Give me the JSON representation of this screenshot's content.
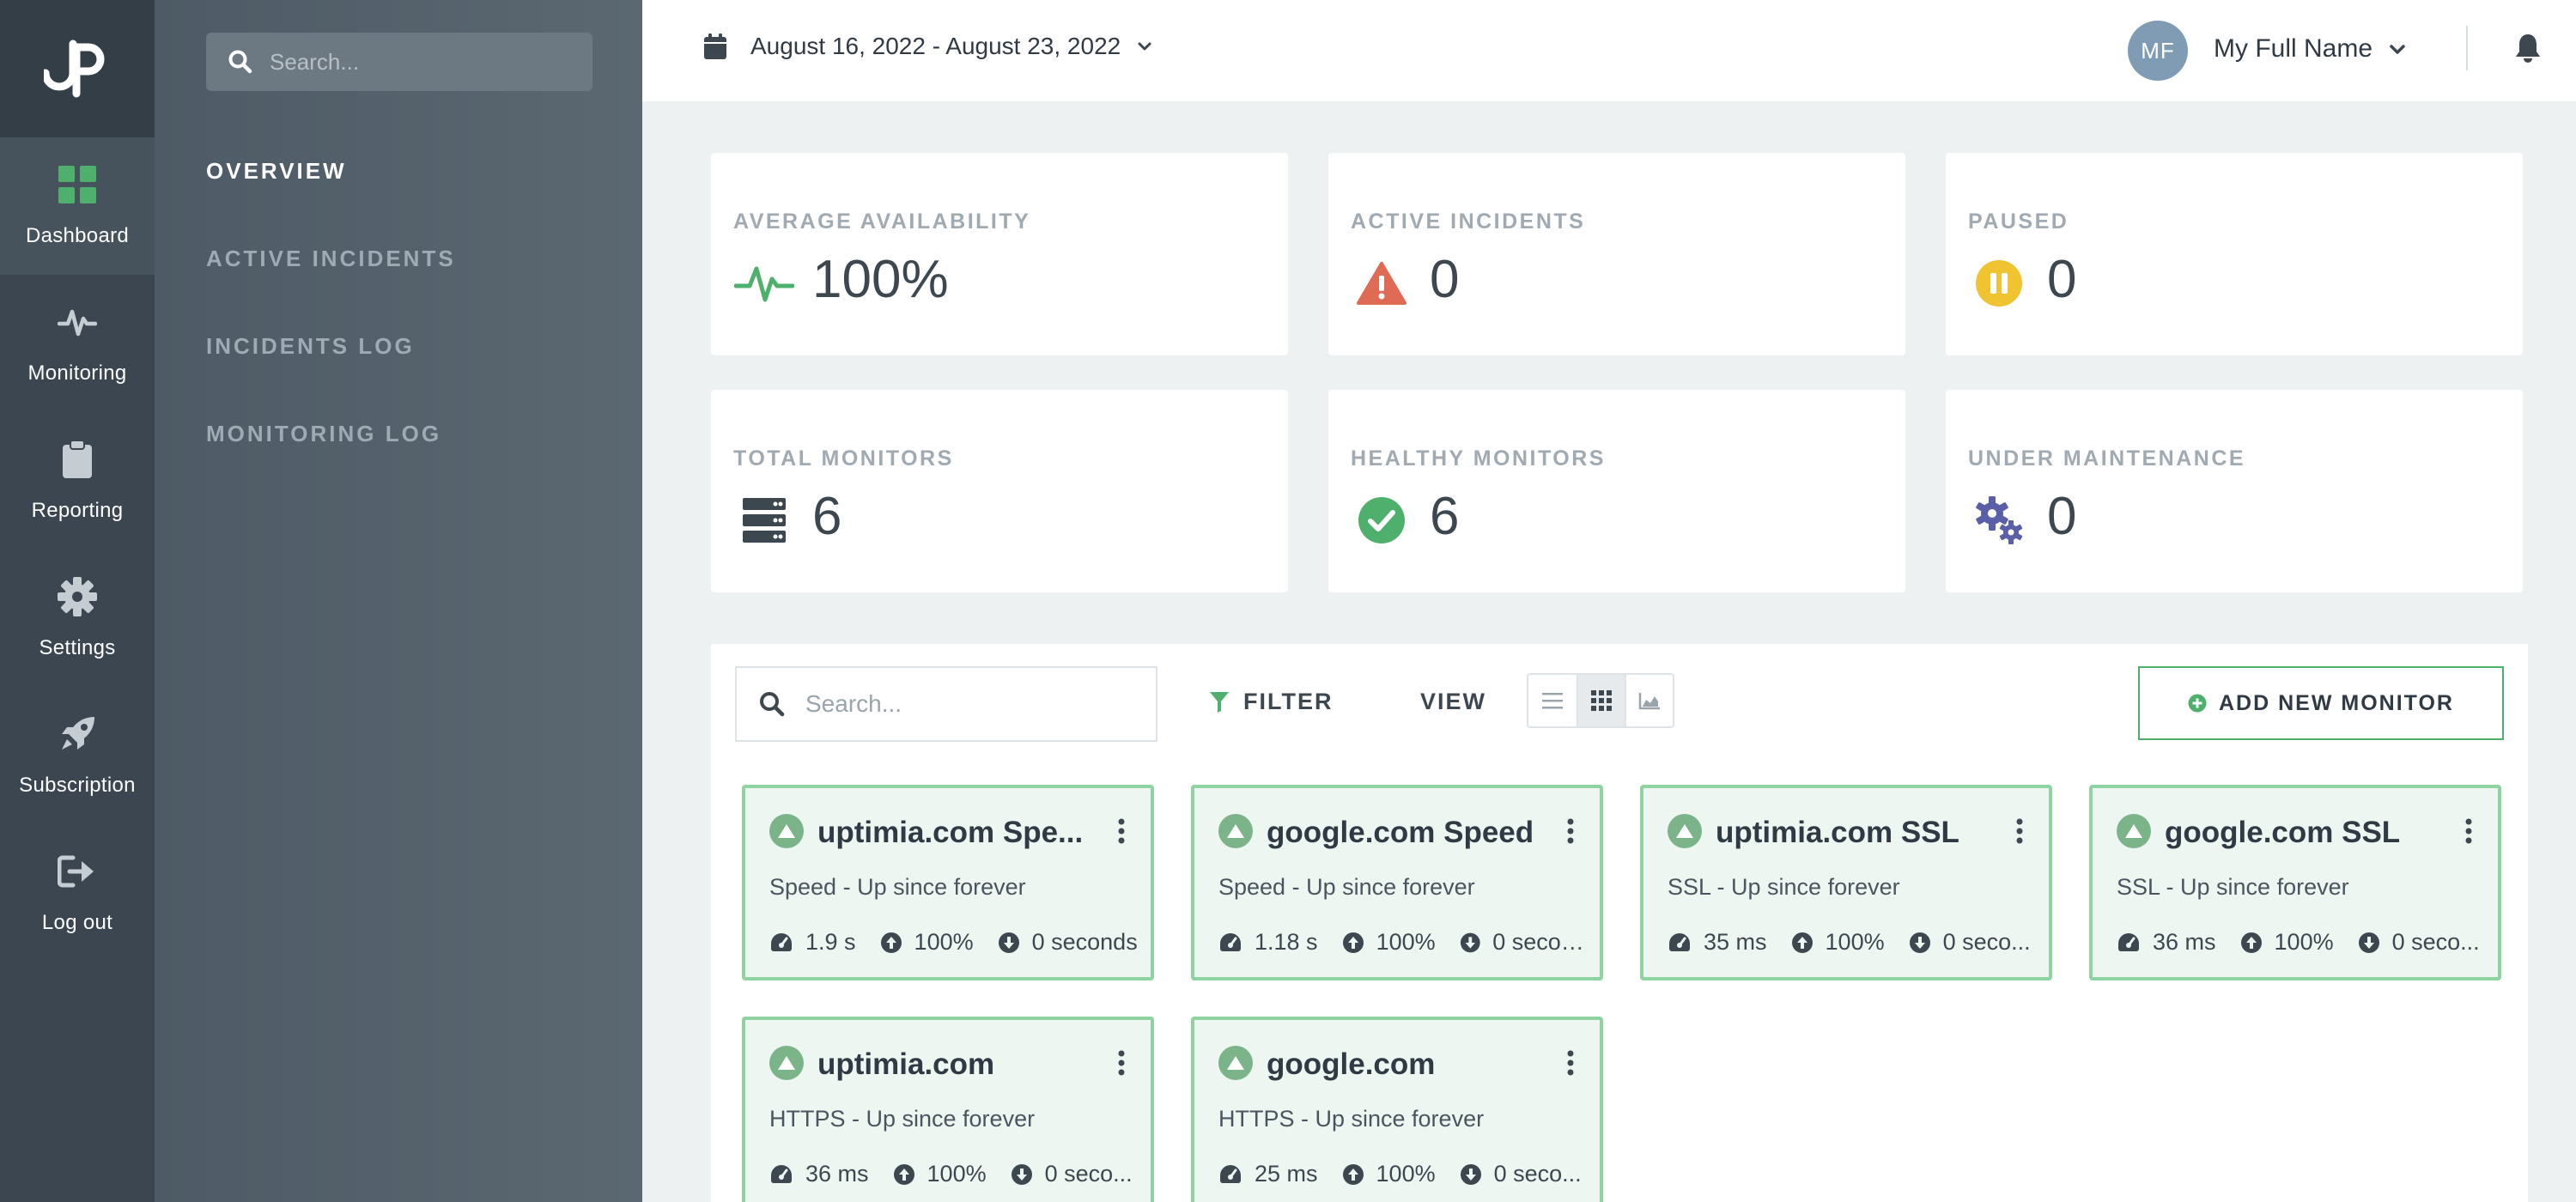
{
  "colors": {
    "accent_green": "#4fb06d",
    "warning_red": "#e06b55",
    "paused_yellow": "#f0c331",
    "maintenance_purple": "#5b5fa8",
    "rail_bg": "#3b4650",
    "card_border_green": "#8fd3a1"
  },
  "rail": {
    "logo": "logo-icon",
    "items": [
      {
        "label": "Dashboard",
        "icon": "dashboard-icon",
        "active": true
      },
      {
        "label": "Monitoring",
        "icon": "pulse-icon"
      },
      {
        "label": "Reporting",
        "icon": "clipboard-icon"
      },
      {
        "label": "Settings",
        "icon": "gear-icon"
      },
      {
        "label": "Subscription",
        "icon": "rocket-icon"
      },
      {
        "label": "Log out",
        "icon": "logout-icon"
      }
    ]
  },
  "subnav": {
    "search_placeholder": "Search...",
    "items": [
      {
        "label": "OVERVIEW",
        "active": true
      },
      {
        "label": "ACTIVE INCIDENTS"
      },
      {
        "label": "INCIDENTS LOG"
      },
      {
        "label": "MONITORING LOG"
      }
    ]
  },
  "topbar": {
    "date_range": "August 16, 2022 - August 23, 2022",
    "avatar_initials": "MF",
    "user_name": "My Full Name"
  },
  "stats": [
    {
      "label": "AVERAGE AVAILABILITY",
      "value": "100%",
      "icon": "pulse-icon"
    },
    {
      "label": "ACTIVE INCIDENTS",
      "value": "0",
      "icon": "warning-icon"
    },
    {
      "label": "PAUSED",
      "value": "0",
      "icon": "pause-icon"
    },
    {
      "label": "TOTAL MONITORS",
      "value": "6",
      "icon": "server-icon"
    },
    {
      "label": "HEALTHY MONITORS",
      "value": "6",
      "icon": "check-circle-icon"
    },
    {
      "label": "UNDER MAINTENANCE",
      "value": "0",
      "icon": "gears-icon"
    }
  ],
  "toolbar": {
    "search_placeholder": "Search...",
    "filter_label": "FILTER",
    "view_label": "VIEW",
    "view_modes": [
      "list",
      "grid",
      "chart"
    ],
    "active_view": "grid",
    "add_label": "ADD NEW MONITOR"
  },
  "monitors": [
    {
      "title": "uptimia.com Spe...",
      "subtitle": "Speed - Up since forever",
      "response": "1.9 s",
      "uptime": "100%",
      "downtime": "0 seconds"
    },
    {
      "title": "google.com Speed",
      "subtitle": "Speed - Up since forever",
      "response": "1.18 s",
      "uptime": "100%",
      "downtime": "0 secon..."
    },
    {
      "title": "uptimia.com SSL",
      "subtitle": "SSL - Up since forever",
      "response": "35 ms",
      "uptime": "100%",
      "downtime": "0 seco..."
    },
    {
      "title": "google.com SSL",
      "subtitle": "SSL - Up since forever",
      "response": "36 ms",
      "uptime": "100%",
      "downtime": "0 seco..."
    },
    {
      "title": "uptimia.com",
      "subtitle": "HTTPS - Up since forever",
      "response": "36 ms",
      "uptime": "100%",
      "downtime": "0 seco..."
    },
    {
      "title": "google.com",
      "subtitle": "HTTPS - Up since forever",
      "response": "25 ms",
      "uptime": "100%",
      "downtime": "0 seco..."
    }
  ]
}
